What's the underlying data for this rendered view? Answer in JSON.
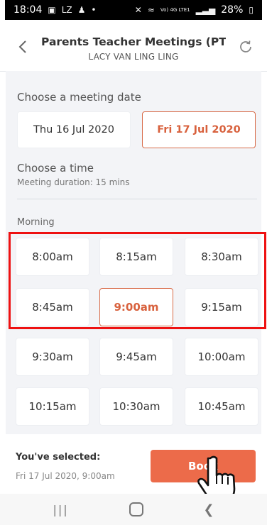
{
  "status_bar": {
    "time": "18:04",
    "left_icons": [
      "image-icon",
      "lz-icon",
      "person-icon",
      "dot-icon"
    ],
    "network": "Vo) 4G LTE1",
    "battery": "28%"
  },
  "header": {
    "title": "Parents Teacher Meetings (PTM..",
    "subtitle": "LACY VAN LING LING",
    "back_icon": "chevron-left-icon",
    "refresh_icon": "refresh-icon"
  },
  "date_section": {
    "label": "Choose a meeting date",
    "options": [
      {
        "label": "Thu 16 Jul 2020",
        "selected": false
      },
      {
        "label": "Fri 17 Jul 2020",
        "selected": true
      }
    ]
  },
  "time_section": {
    "label": "Choose a time",
    "duration": "Meeting duration: 15 mins",
    "period": "Morning",
    "slots": [
      {
        "label": "8:00am",
        "selected": false
      },
      {
        "label": "8:15am",
        "selected": false
      },
      {
        "label": "8:30am",
        "selected": false
      },
      {
        "label": "8:45am",
        "selected": false
      },
      {
        "label": "9:00am",
        "selected": true
      },
      {
        "label": "9:15am",
        "selected": false
      },
      {
        "label": "9:30am",
        "selected": false
      },
      {
        "label": "9:45am",
        "selected": false
      },
      {
        "label": "10:00am",
        "selected": false
      },
      {
        "label": "10:15am",
        "selected": false
      },
      {
        "label": "10:30am",
        "selected": false
      },
      {
        "label": "10:45am",
        "selected": false
      }
    ]
  },
  "footer": {
    "selected_label": "You've selected:",
    "selected_value": "Fri 17 Jul 2020, 9:00am",
    "book_label": "Book"
  },
  "colors": {
    "accent": "#ec6b4a",
    "selected_text": "#d8613d",
    "highlight": "#ee1111",
    "background": "#f3f4f7"
  }
}
